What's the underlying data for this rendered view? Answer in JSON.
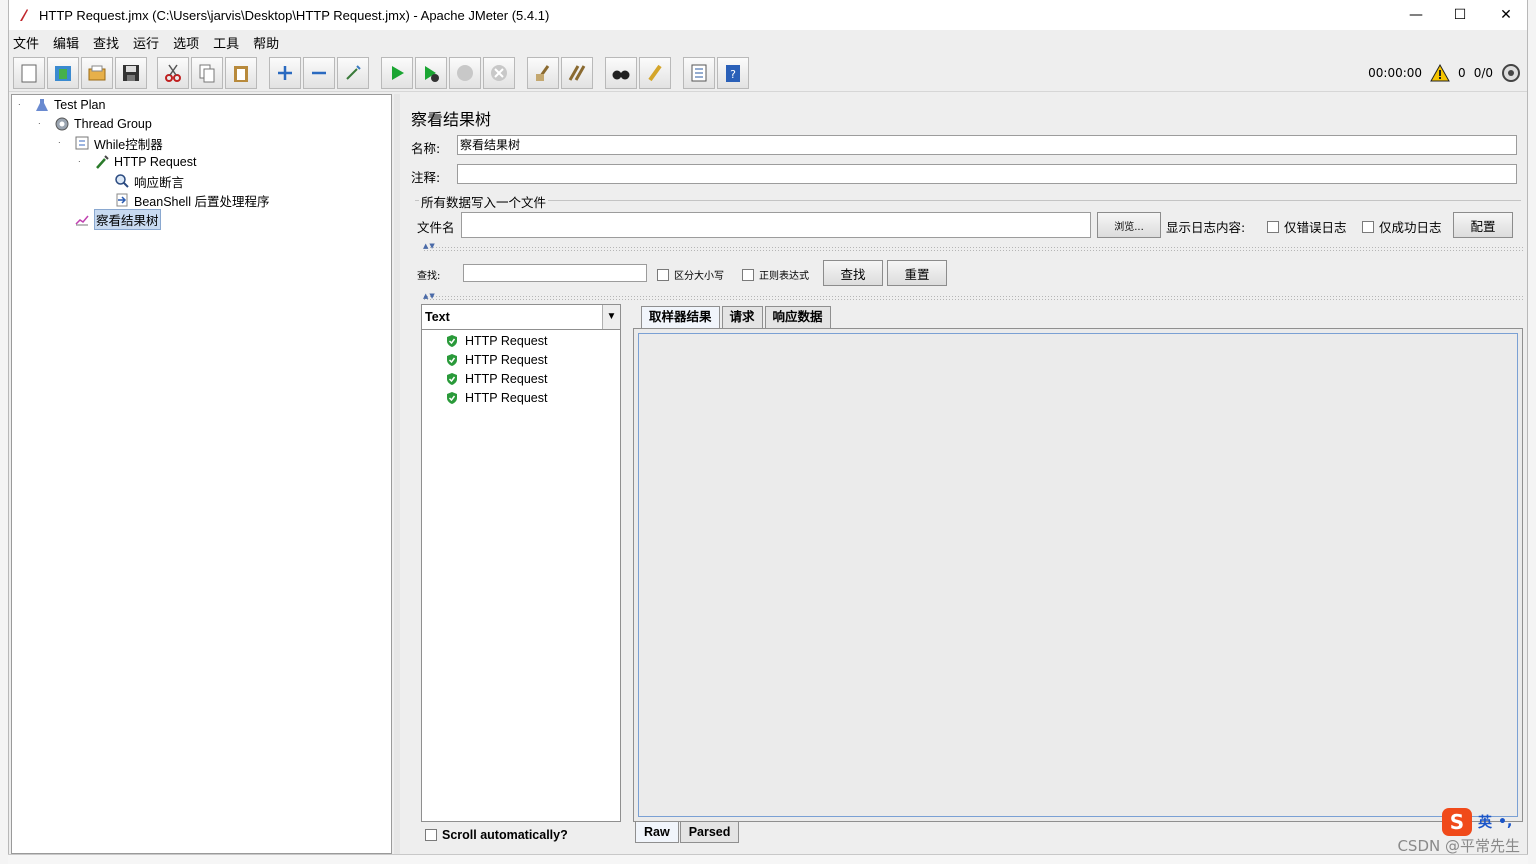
{
  "window": {
    "title": "HTTP Request.jmx (C:\\Users\\jarvis\\Desktop\\HTTP Request.jmx) - Apache JMeter (5.4.1)",
    "minimize": "—",
    "maximize": "☐",
    "close": "✕"
  },
  "menu": [
    "文件",
    "编辑",
    "查找",
    "运行",
    "选项",
    "工具",
    "帮助"
  ],
  "toolbar": {
    "buttons": [
      "new",
      "templates",
      "open",
      "save",
      "cut",
      "copy",
      "paste",
      "expand",
      "collapse",
      "toggle",
      "start",
      "start-no-pauses",
      "stop",
      "shutdown",
      "clear",
      "clear-all",
      "search",
      "reset-search",
      "function-helper",
      "help"
    ]
  },
  "status": {
    "elapsed": "00:00:00",
    "warnings": "0",
    "threads": "0/0"
  },
  "tree": {
    "items": [
      {
        "label": "Test Plan",
        "icon": "flask-icon"
      },
      {
        "label": "Thread Group",
        "icon": "gear-icon"
      },
      {
        "label": "While控制器",
        "icon": "controller-icon"
      },
      {
        "label": "HTTP Request",
        "icon": "pipette-icon"
      },
      {
        "label": "响应断言",
        "icon": "magnifier-icon"
      },
      {
        "label": "BeanShell 后置处理程序",
        "icon": "arrow-doc-icon"
      },
      {
        "label": "察看结果树",
        "icon": "graph-icon"
      }
    ]
  },
  "panel": {
    "title": "察看结果树",
    "name_label": "名称:",
    "name_value": "察看结果树",
    "comment_label": "注释:",
    "comment_value": "",
    "file_group_title": "所有数据写入一个文件",
    "filename_label": "文件名",
    "filename_value": "",
    "browse_button": "浏览...",
    "log_label": "显示日志内容:",
    "errors_only": "仅错误日志",
    "success_only": "仅成功日志",
    "config_button": "配置",
    "search_label": "查找:",
    "search_value": "",
    "case_sensitive": "区分大小写",
    "regex": "正则表达式",
    "find_button": "查找",
    "reset_button": "重置",
    "renderer": "Text",
    "results": [
      "HTTP Request",
      "HTTP Request",
      "HTTP Request",
      "HTTP Request"
    ],
    "tabs": [
      "取样器结果",
      "请求",
      "响应数据"
    ],
    "subtabs": [
      "Raw",
      "Parsed"
    ],
    "scroll_auto": "Scroll automatically?"
  },
  "watermark": "CSDN @平常先生",
  "ime": {
    "logo": "S",
    "mode": "英",
    "punct": "•,"
  }
}
